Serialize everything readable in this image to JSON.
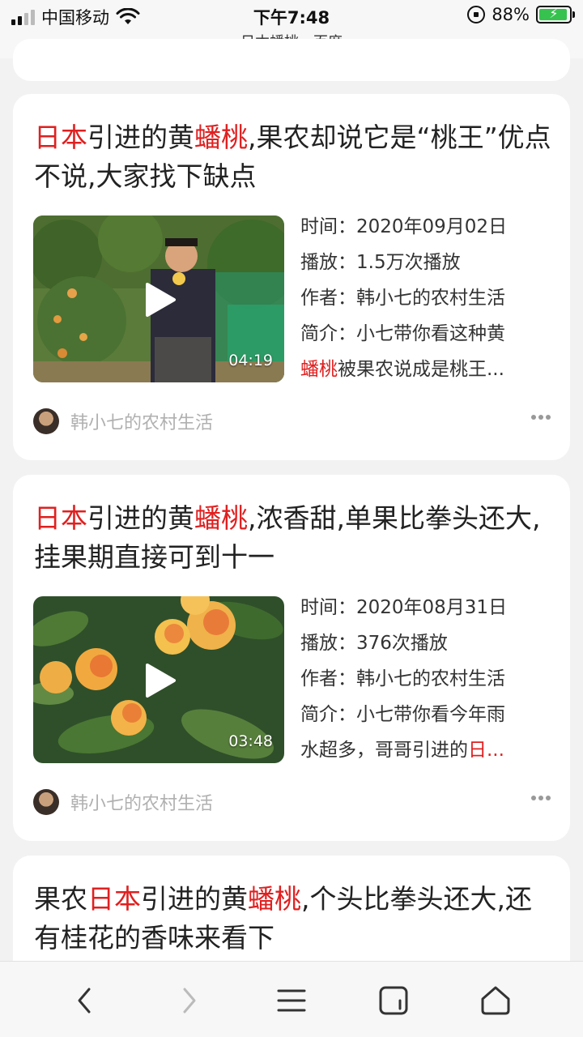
{
  "status_bar": {
    "carrier": "中国移动",
    "time": "下午7:48",
    "page_title": "日本蟠桃 - 百度",
    "battery": "88%"
  },
  "results": [
    {
      "title_parts": [
        {
          "text": "日本",
          "highlight": true
        },
        {
          "text": "引进的黄",
          "highlight": false
        },
        {
          "text": "蟠桃",
          "highlight": true
        },
        {
          "text": ",果农却说它是“桃王”优点不说,大家找下缺点",
          "highlight": false
        }
      ],
      "duration": "04:19",
      "time_label": "时间：",
      "time_value": "2020年09月02日",
      "plays_label": "播放：",
      "plays_value": "1.5万次播放",
      "author_label": "作者：",
      "author_value": "韩小七的农村生活",
      "summary_label": "简介：",
      "summary_line1": "小七带你看这种黄",
      "summary_line2_parts": [
        {
          "text": "蟠桃",
          "highlight": true
        },
        {
          "text": "被果农说成是桃王...",
          "highlight": false
        }
      ],
      "source": "韩小七的农村生活"
    },
    {
      "title_parts": [
        {
          "text": "日本",
          "highlight": true
        },
        {
          "text": "引进的黄",
          "highlight": false
        },
        {
          "text": "蟠桃",
          "highlight": true
        },
        {
          "text": ",浓香甜,单果比拳头还大,挂果期直接可到十一",
          "highlight": false
        }
      ],
      "duration": "03:48",
      "time_label": "时间：",
      "time_value": "2020年08月31日",
      "plays_label": "播放：",
      "plays_value": "376次播放",
      "author_label": "作者：",
      "author_value": "韩小七的农村生活",
      "summary_label": "简介：",
      "summary_line1": "小七带你看今年雨",
      "summary_line2_parts": [
        {
          "text": "水超多，哥哥引进的",
          "highlight": false
        },
        {
          "text": "日...",
          "highlight": true
        }
      ],
      "source": "韩小七的农村生活"
    },
    {
      "title_parts": [
        {
          "text": "果农",
          "highlight": false
        },
        {
          "text": "日本",
          "highlight": true
        },
        {
          "text": "引进的黄",
          "highlight": false
        },
        {
          "text": "蟠桃",
          "highlight": true
        },
        {
          "text": ",个头比拳头还大,还有桂花的香味来看下",
          "highlight": false
        }
      ]
    }
  ],
  "colors": {
    "highlight": "#e02020",
    "background": "#f2f2f2",
    "card": "#ffffff",
    "muted": "#b0b0b0"
  },
  "icons": [
    "signal-icon",
    "wifi-icon",
    "rotation-lock-icon",
    "battery-icon",
    "play-icon",
    "more-icon",
    "back-icon",
    "forward-icon",
    "menu-icon",
    "tabs-icon",
    "home-icon"
  ]
}
